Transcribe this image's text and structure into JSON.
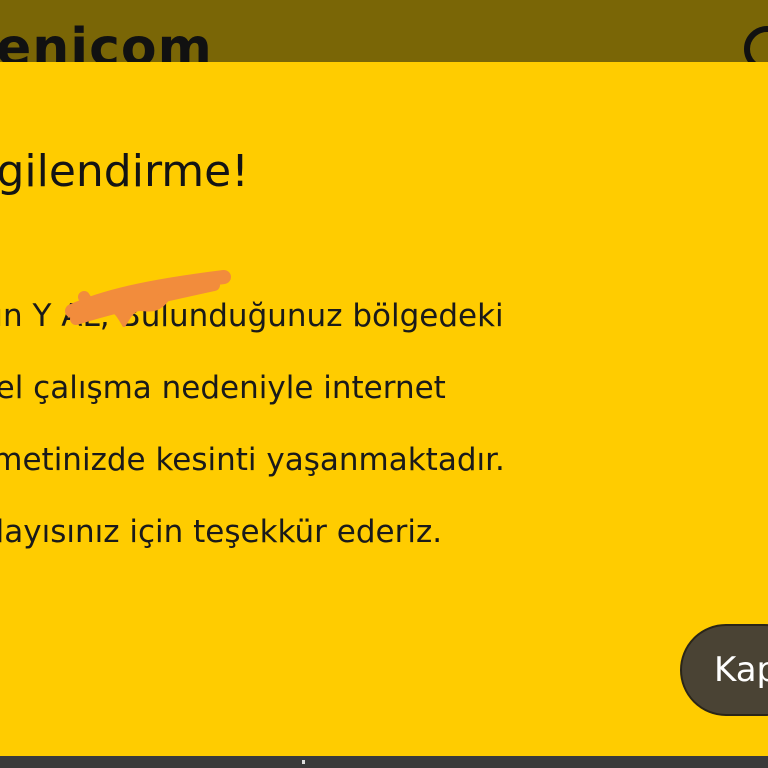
{
  "header": {
    "logo_text": "enicom"
  },
  "modal": {
    "title": "ilgilendirme!",
    "message_lines": [
      "yın Y   AL, Bulunduğunuz bölgedeki",
      "nel çalışma nedeniyle internet",
      "zmetinizde kesinti yaşanmaktadır.",
      "nlayısınız için teşekkür ederiz."
    ],
    "close_label": "Kapat"
  },
  "colors": {
    "modal_background": "#ffcc00",
    "backdrop": "#7a6606",
    "button_background": "#4a4334",
    "redaction": "#f28c3c"
  }
}
